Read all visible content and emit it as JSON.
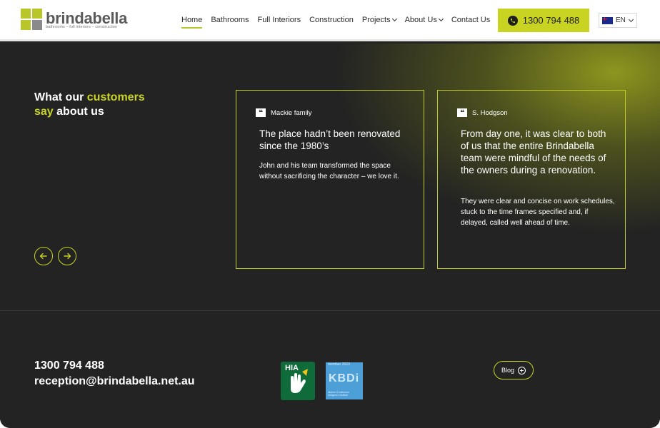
{
  "header": {
    "logo": {
      "word": "brindabella",
      "tagline": "bathrooms – full interiors – construction"
    },
    "nav": [
      {
        "label": "Home",
        "active": true,
        "dropdown": false
      },
      {
        "label": "Bathrooms",
        "active": false,
        "dropdown": false
      },
      {
        "label": "Full Interiors",
        "active": false,
        "dropdown": false
      },
      {
        "label": "Construction",
        "active": false,
        "dropdown": false
      },
      {
        "label": "Projects",
        "active": false,
        "dropdown": true
      },
      {
        "label": "About Us",
        "active": false,
        "dropdown": true
      },
      {
        "label": "Contact Us",
        "active": false,
        "dropdown": false
      }
    ],
    "phone_label": "1300 794 488",
    "language": "EN"
  },
  "testimonials": {
    "heading": {
      "part1": "What our ",
      "highlight1": "customers",
      "highlight2": "say",
      "part2": " about us"
    },
    "cards": [
      {
        "author": "Mackie family",
        "headline": "The place hadn’t been renovated since the 1980’s",
        "body": "John and his team transformed the space without sacrificing the character – we love it."
      },
      {
        "author": "S. Hodgson",
        "headline": "From day one, it was clear to both of us that the entire Brindabella team were mindful of the needs of the owners during a renovation.",
        "body": "They were clear and concise on work schedules, stuck to the time frames specified and, if delayed, called well ahead of time."
      }
    ]
  },
  "footer": {
    "phone": "1300 794 488",
    "email": "reception@brindabella.net.au",
    "hia_label": "HIA",
    "kbdi": {
      "top": "member 2023",
      "mid": "KBDi",
      "bottom": "kitchen & bathroom designers institute"
    },
    "blog_label": "Blog"
  },
  "colors": {
    "accent": "#c8d322",
    "dark": "#232323",
    "logo_lime": "#b9c62a",
    "logo_gray": "#8a8a8a"
  }
}
